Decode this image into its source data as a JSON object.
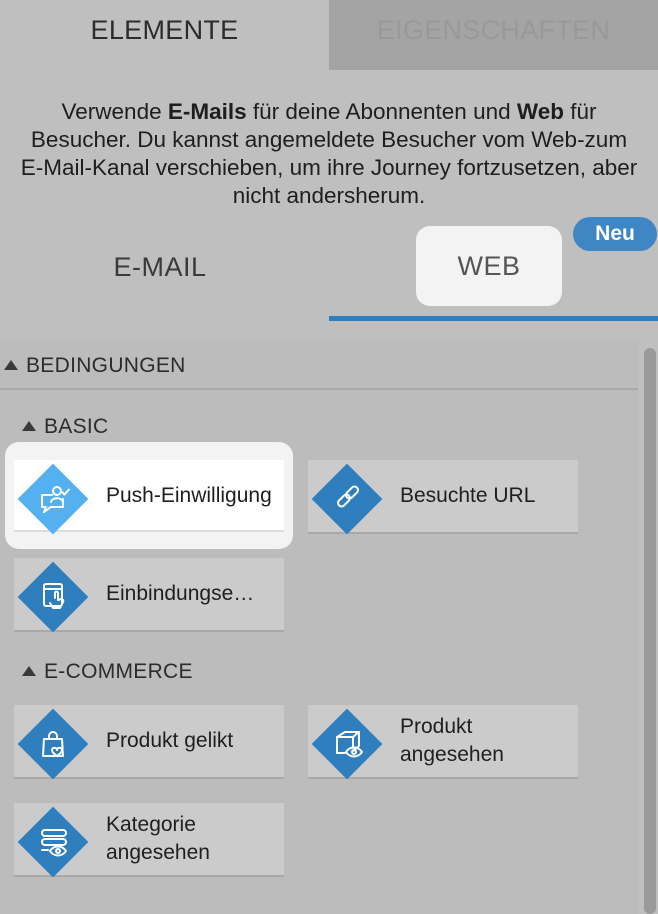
{
  "tabs": {
    "elements": "ELEMENTE",
    "properties": "EIGENSCHAFTEN"
  },
  "description": {
    "t1": "Verwende ",
    "b1": "E-Mails",
    "t2": " für deine Abonnenten und ",
    "b2": "Web",
    "t3": " für Besucher. Du kannst angemeldete Besucher vom Web-zum E-Mail-Kanal verschieben, um ihre Journey fortzusetzen, aber nicht andersherum."
  },
  "channels": {
    "email": "E-MAIL",
    "web": "WEB",
    "new_badge": "Neu",
    "active": "web"
  },
  "colors": {
    "accent": "#2f7fbf",
    "accent_light": "#55b0f0",
    "badge": "#3f86c4"
  },
  "conditions": {
    "header": "BEDINGUNGEN",
    "groups": [
      {
        "title": "BASIC",
        "items": [
          {
            "label": "Push-Einwilligung",
            "icon": "push-consent-icon",
            "selected": true
          },
          {
            "label": "Besuchte URL",
            "icon": "link-icon",
            "selected": false
          },
          {
            "label": "Einbindungse…",
            "icon": "touch-interaction-icon",
            "selected": false
          }
        ]
      },
      {
        "title": "E-COMMERCE",
        "items": [
          {
            "label": "Produkt gelikt",
            "icon": "bag-heart-icon",
            "selected": false
          },
          {
            "label": "Produkt angesehen",
            "icon": "box-eye-icon",
            "selected": false
          },
          {
            "label": "Kategorie angesehen",
            "icon": "list-eye-icon",
            "selected": false
          }
        ]
      }
    ]
  }
}
